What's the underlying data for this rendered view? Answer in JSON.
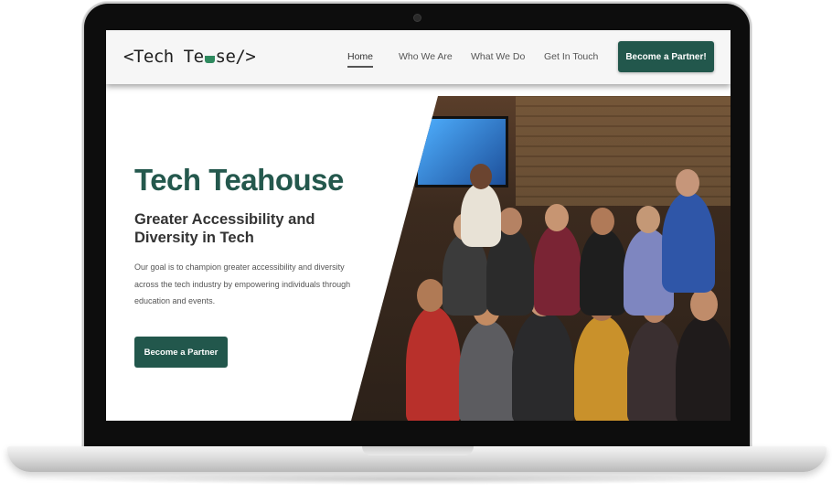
{
  "nav": {
    "logo_left": "<Tech Te",
    "logo_right": "se/>",
    "links": [
      "Home",
      "Who We Are",
      "What We Do",
      "Get In Touch"
    ],
    "active": "Home",
    "cta": "Become a Partner!"
  },
  "hero": {
    "title": "Tech Teahouse",
    "subtitle": "Greater Accessibility and Diversity in Tech",
    "body": "Our goal is to champion greater accessibility and diversity across the tech industry by empowering individuals through education and events.",
    "cta": "Become a Partner"
  },
  "colors": {
    "brand": "#22574c",
    "title": "#24584d"
  },
  "icons": [
    "teacup-icon"
  ]
}
